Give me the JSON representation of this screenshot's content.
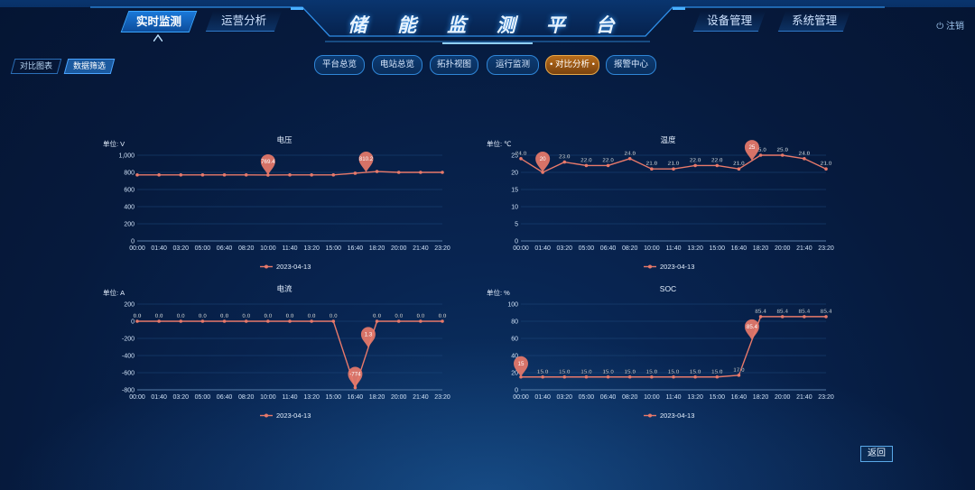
{
  "header": {
    "title": "储 能 监 测 平 台",
    "left_tabs": [
      "实时监测",
      "运营分析"
    ],
    "right_tabs": [
      "设备管理",
      "系统管理"
    ],
    "active_tab": "实时监测",
    "logout_label": "注销"
  },
  "sub_tabs": {
    "items": [
      "对比图表",
      "数据筛选"
    ],
    "active": "数据筛选"
  },
  "pills": {
    "items": [
      "平台总览",
      "电站总览",
      "拓扑视图",
      "运行监测",
      "对比分析",
      "报警中心"
    ],
    "active": "对比分析",
    "active_marker": "•"
  },
  "back_label": "返回",
  "colors": {
    "line": "#e8796a",
    "accent": "#3aa6ff",
    "active_pill": "#c77a25"
  },
  "chart_data": [
    {
      "type": "line",
      "title": "电压",
      "unit_label": "单位: V",
      "x": [
        "00:00",
        "01:40",
        "03:20",
        "05:00",
        "06:40",
        "08:20",
        "10:00",
        "11:40",
        "13:20",
        "15:00",
        "16:40",
        "18:20",
        "20:00",
        "21:40",
        "23:20"
      ],
      "y_ticks": [
        "1,000",
        "800",
        "600",
        "400",
        "200",
        "0"
      ],
      "ylim": [
        0,
        1000
      ],
      "series": [
        {
          "name": "2023-04-13",
          "values": [
            770,
            770,
            770,
            770,
            770,
            770,
            769,
            770,
            770,
            770,
            790,
            810,
            800,
            800,
            800
          ]
        }
      ],
      "pins": [
        {
          "x_index": 6,
          "label": "769.4"
        },
        {
          "x_index": 10.5,
          "label": "810.2"
        }
      ],
      "data_labels": [],
      "legend": "2023-04-13",
      "legend_position": "bottom"
    },
    {
      "type": "line",
      "title": "温度",
      "unit_label": "单位: ℃",
      "x": [
        "00:00",
        "01:40",
        "03:20",
        "05:00",
        "06:40",
        "08:20",
        "10:00",
        "11:40",
        "13:20",
        "15:00",
        "16:40",
        "18:20",
        "20:00",
        "21:40",
        "23:20"
      ],
      "y_ticks": [
        "25",
        "20",
        "15",
        "10",
        "5",
        "0"
      ],
      "ylim": [
        0,
        25
      ],
      "series": [
        {
          "name": "2023-04-13",
          "values": [
            24,
            20,
            23,
            22,
            22,
            24,
            21,
            21,
            22,
            22,
            21,
            25,
            25,
            24,
            21
          ]
        }
      ],
      "pins": [
        {
          "x_index": 1,
          "label": "20"
        },
        {
          "x_index": 10.6,
          "label": "25"
        }
      ],
      "data_labels": [
        {
          "x_index": 0,
          "label": "24.0"
        },
        {
          "x_index": 2,
          "label": "23.0"
        },
        {
          "x_index": 3,
          "label": "22.0"
        },
        {
          "x_index": 4,
          "label": "22.0"
        },
        {
          "x_index": 5,
          "label": "24.0"
        },
        {
          "x_index": 6,
          "label": "21.0"
        },
        {
          "x_index": 7,
          "label": "21.0"
        },
        {
          "x_index": 8,
          "label": "22.0"
        },
        {
          "x_index": 9,
          "label": "22.0"
        },
        {
          "x_index": 10,
          "label": "21.0"
        },
        {
          "x_index": 11,
          "label": "25.0"
        },
        {
          "x_index": 12,
          "label": "25.0"
        },
        {
          "x_index": 13,
          "label": "24.0"
        },
        {
          "x_index": 14,
          "label": "21.0"
        }
      ],
      "legend": "2023-04-13",
      "legend_position": "bottom"
    },
    {
      "type": "line",
      "title": "电流",
      "unit_label": "单位: A",
      "x": [
        "00:00",
        "01:40",
        "03:20",
        "05:00",
        "06:40",
        "08:20",
        "10:00",
        "11:40",
        "13:20",
        "15:00",
        "16:40",
        "18:20",
        "20:00",
        "21:40",
        "23:20"
      ],
      "y_ticks": [
        "200",
        "0",
        "-200",
        "-400",
        "-600",
        "-800"
      ],
      "ylim": [
        -800,
        200
      ],
      "series": [
        {
          "name": "2023-04-13",
          "values": [
            0,
            0,
            0,
            0,
            0,
            0,
            0,
            0,
            0,
            0,
            -774,
            0,
            0,
            0,
            0
          ]
        }
      ],
      "pins": [
        {
          "x_index": 10,
          "label": "-774"
        },
        {
          "x_index": 10.6,
          "label": "1.3"
        }
      ],
      "data_labels": [
        {
          "x_index": 0,
          "label": "0.0"
        },
        {
          "x_index": 1,
          "label": "0.0"
        },
        {
          "x_index": 2,
          "label": "0.0"
        },
        {
          "x_index": 3,
          "label": "0.0"
        },
        {
          "x_index": 4,
          "label": "0.0"
        },
        {
          "x_index": 5,
          "label": "0.0"
        },
        {
          "x_index": 6,
          "label": "0.0"
        },
        {
          "x_index": 7,
          "label": "0.0"
        },
        {
          "x_index": 8,
          "label": "0.0"
        },
        {
          "x_index": 9,
          "label": "0.0"
        },
        {
          "x_index": 11,
          "label": "0.0"
        },
        {
          "x_index": 12,
          "label": "0.0"
        },
        {
          "x_index": 13,
          "label": "0.0"
        },
        {
          "x_index": 14,
          "label": "0.0"
        }
      ],
      "legend": "2023-04-13",
      "legend_position": "bottom"
    },
    {
      "type": "line",
      "title": "SOC",
      "unit_label": "单位: %",
      "x": [
        "00:00",
        "01:40",
        "03:20",
        "05:00",
        "06:40",
        "08:20",
        "10:00",
        "11:40",
        "13:20",
        "15:00",
        "16:40",
        "18:20",
        "20:00",
        "21:40",
        "23:20"
      ],
      "y_ticks": [
        "100",
        "80",
        "60",
        "40",
        "20",
        "0"
      ],
      "ylim": [
        0,
        100
      ],
      "series": [
        {
          "name": "2023-04-13",
          "values": [
            15,
            15,
            15,
            15,
            15,
            15,
            15,
            15,
            15,
            15,
            17,
            85.4,
            85.4,
            85.4,
            85.4
          ]
        }
      ],
      "pins": [
        {
          "x_index": 0,
          "label": "15"
        },
        {
          "x_index": 10.6,
          "label": "85.4"
        }
      ],
      "data_labels": [
        {
          "x_index": 1,
          "label": "15.0"
        },
        {
          "x_index": 2,
          "label": "15.0"
        },
        {
          "x_index": 3,
          "label": "15.0"
        },
        {
          "x_index": 4,
          "label": "15.0"
        },
        {
          "x_index": 5,
          "label": "15.0"
        },
        {
          "x_index": 6,
          "label": "15.0"
        },
        {
          "x_index": 7,
          "label": "15.0"
        },
        {
          "x_index": 8,
          "label": "15.0"
        },
        {
          "x_index": 9,
          "label": "15.0"
        },
        {
          "x_index": 10,
          "label": "17.0"
        },
        {
          "x_index": 11,
          "label": "85.4"
        },
        {
          "x_index": 12,
          "label": "85.4"
        },
        {
          "x_index": 13,
          "label": "85.4"
        },
        {
          "x_index": 14,
          "label": "85.4"
        }
      ],
      "legend": "2023-04-13",
      "legend_position": "bottom"
    }
  ]
}
